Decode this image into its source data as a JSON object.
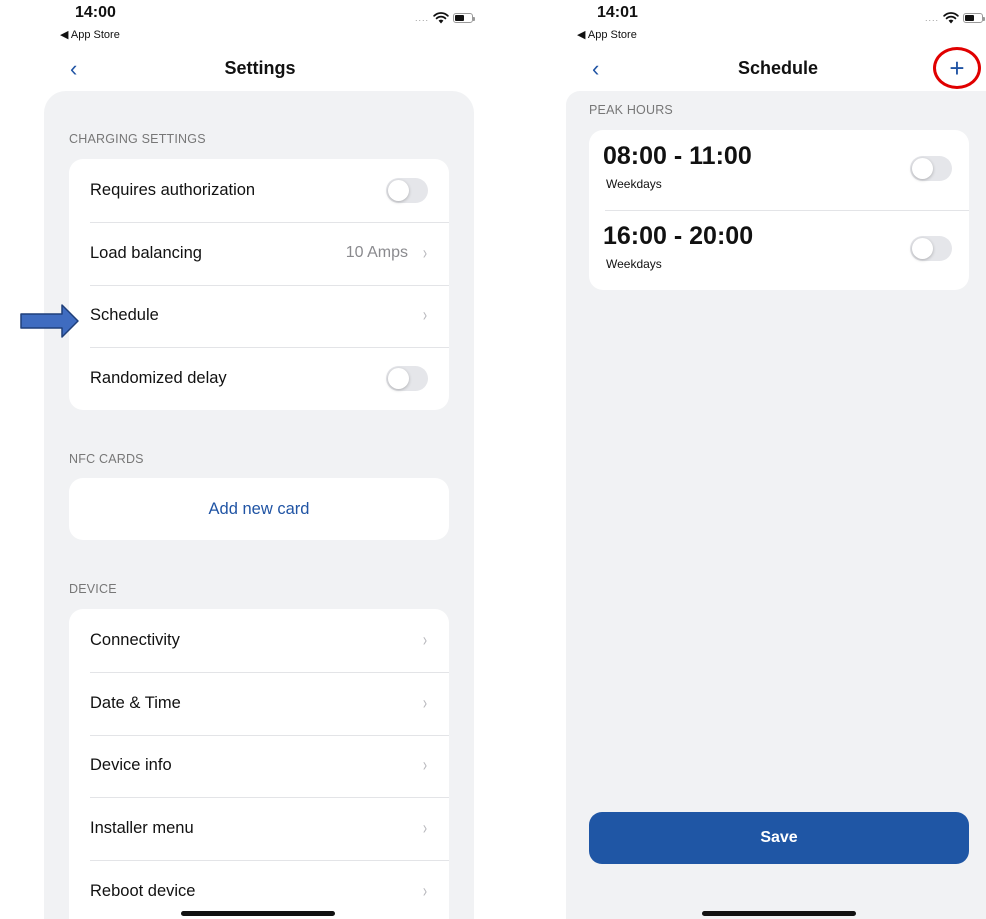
{
  "settings_screen": {
    "status": {
      "time": "14:00",
      "back_app": "◀ App Store"
    },
    "nav": {
      "back_glyph": "‹",
      "title": "Settings"
    },
    "charging": {
      "header": "CHARGING SETTINGS",
      "rows": [
        {
          "label": "Requires authorization"
        },
        {
          "label": "Load balancing",
          "value": "10 Amps"
        },
        {
          "label": "Schedule"
        },
        {
          "label": "Randomized delay"
        }
      ]
    },
    "nfc": {
      "header": "NFC CARDS",
      "add_label": "Add new card"
    },
    "device": {
      "header": "DEVICE",
      "rows": [
        {
          "label": "Connectivity"
        },
        {
          "label": "Date & Time"
        },
        {
          "label": "Device info"
        },
        {
          "label": "Installer menu"
        },
        {
          "label": "Reboot device"
        }
      ]
    },
    "chevron_glyph": "›"
  },
  "schedule_screen": {
    "status": {
      "time": "14:01",
      "back_app": "◀ App Store"
    },
    "nav": {
      "back_glyph": "‹",
      "title": "Schedule",
      "add_glyph": "+"
    },
    "peak": {
      "header": "PEAK HOURS",
      "items": [
        {
          "time": "08:00 - 11:00",
          "days": "Weekdays"
        },
        {
          "time": "16:00 - 20:00",
          "days": "Weekdays"
        }
      ]
    },
    "save_label": "Save"
  },
  "colors": {
    "accent_blue": "#2054a4",
    "annotation_red": "#e00000",
    "annotation_arrow": "#3f6cc0",
    "sheet_bg": "#f1f2f4"
  }
}
